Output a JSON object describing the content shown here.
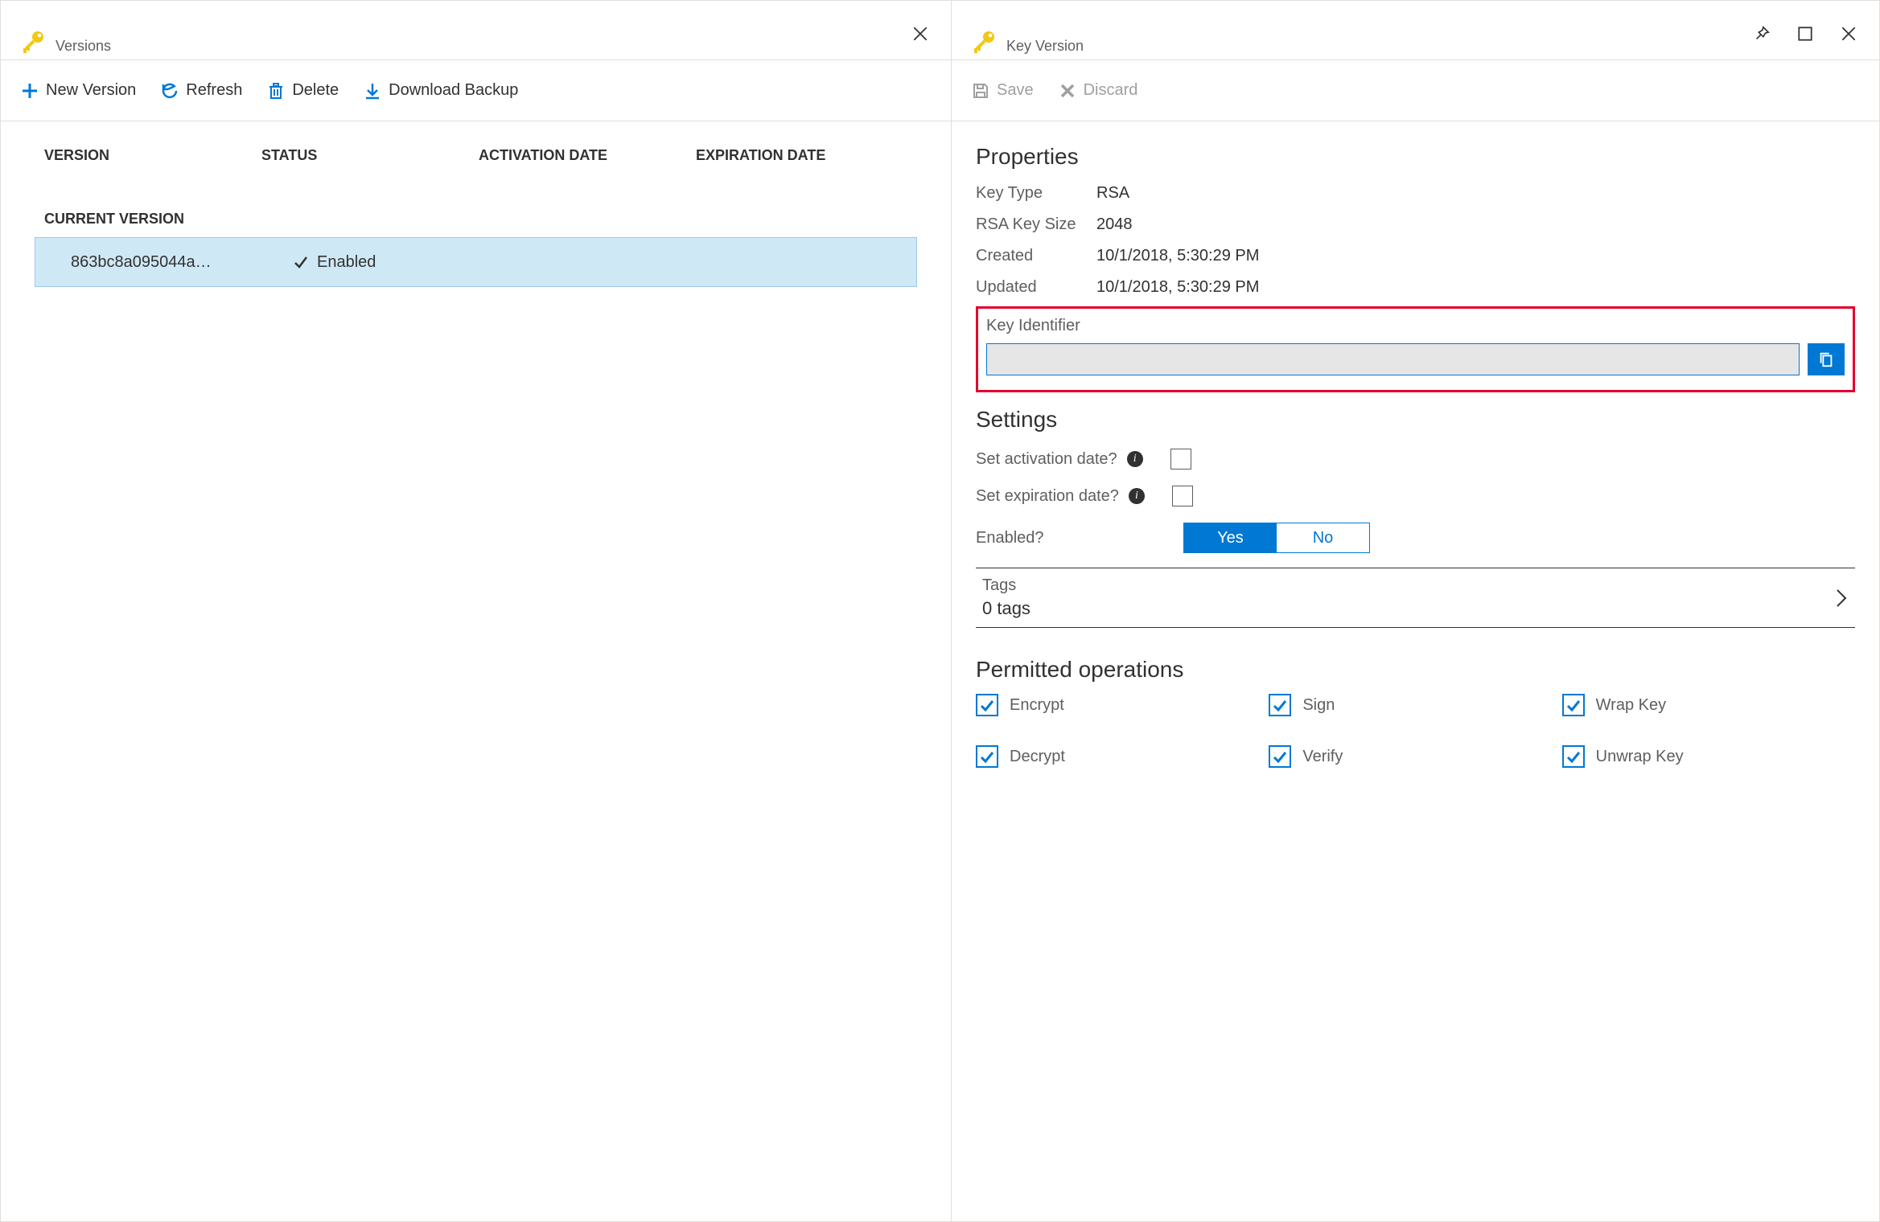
{
  "left": {
    "title": "Versions",
    "toolbar": {
      "new_version": "New Version",
      "refresh": "Refresh",
      "delete": "Delete",
      "download_backup": "Download Backup"
    },
    "columns": {
      "version": "VERSION",
      "status": "STATUS",
      "activation": "ACTIVATION DATE",
      "expiration": "EXPIRATION DATE"
    },
    "current_version_label": "CURRENT VERSION",
    "current_row": {
      "version": "863bc8a095044a…",
      "status": "Enabled"
    }
  },
  "right": {
    "title": "Key Version",
    "toolbar": {
      "save": "Save",
      "discard": "Discard"
    },
    "properties": {
      "heading": "Properties",
      "key_type_label": "Key Type",
      "key_type_value": "RSA",
      "rsa_size_label": "RSA Key Size",
      "rsa_size_value": "2048",
      "created_label": "Created",
      "created_value": "10/1/2018, 5:30:29 PM",
      "updated_label": "Updated",
      "updated_value": "10/1/2018, 5:30:29 PM",
      "key_identifier_label": "Key Identifier"
    },
    "settings": {
      "heading": "Settings",
      "activation_label": "Set activation date?",
      "expiration_label": "Set expiration date?",
      "enabled_label": "Enabled?",
      "enabled_yes": "Yes",
      "enabled_no": "No"
    },
    "tags": {
      "title": "Tags",
      "count": "0 tags"
    },
    "permitted": {
      "heading": "Permitted operations",
      "ops": [
        "Encrypt",
        "Sign",
        "Wrap Key",
        "Decrypt",
        "Verify",
        "Unwrap Key"
      ]
    }
  }
}
